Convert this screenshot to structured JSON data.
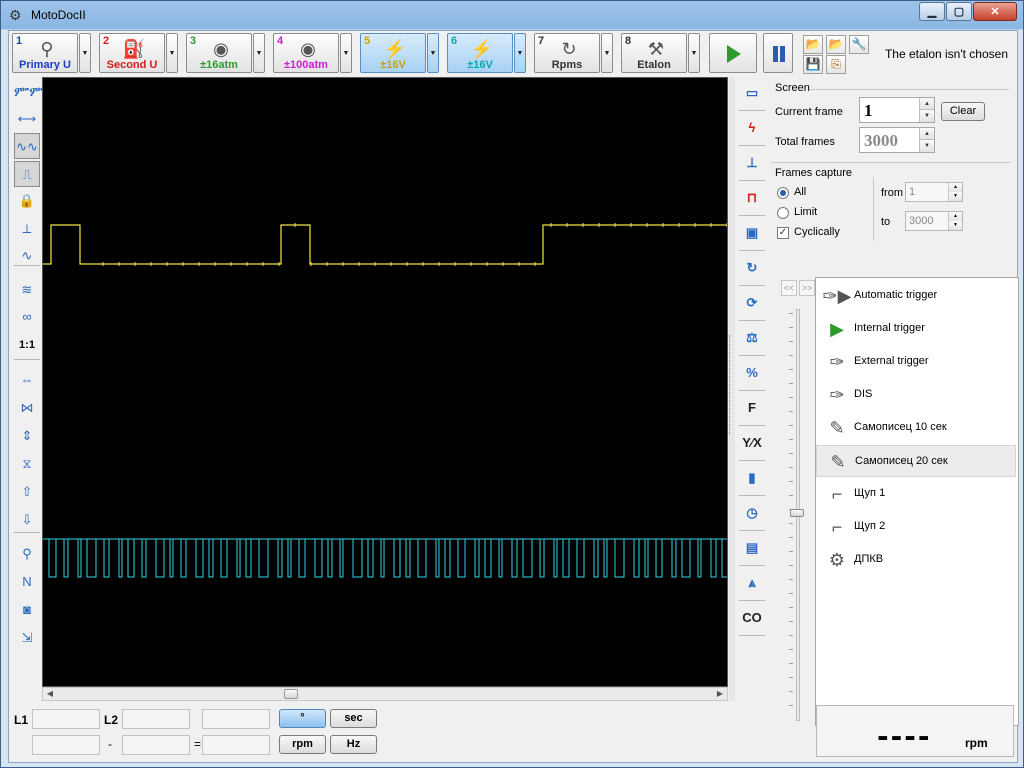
{
  "window": {
    "title": "MotoDocII",
    "min_label": "▁",
    "max_label": "▢",
    "close_label": "✕"
  },
  "toolbar": {
    "channels": [
      {
        "num": "1",
        "label": "Primary U",
        "num_color": "#1a3cc8",
        "label_color": "#1a3cc8",
        "icon": "ignition-coil-icon",
        "glyph": "⚲",
        "active": false
      },
      {
        "num": "2",
        "label": "Second U",
        "num_color": "#d01c1c",
        "label_color": "#d01c1c",
        "icon": "spark-plug-icon",
        "glyph": "⛽",
        "active": false
      },
      {
        "num": "3",
        "label": "±16atm",
        "num_color": "#2e9a2e",
        "label_color": "#2e9a2e",
        "icon": "pressure-sensor-icon",
        "glyph": "◉",
        "active": false
      },
      {
        "num": "4",
        "label": "±100atm",
        "num_color": "#d01cd0",
        "label_color": "#d01cd0",
        "icon": "pressure-sensor-icon",
        "glyph": "◉",
        "active": false
      },
      {
        "num": "5",
        "label": "±16V",
        "num_color": "#c9a400",
        "label_color": "#c9a400",
        "icon": "probe-icon",
        "glyph": "⚡",
        "active": true
      },
      {
        "num": "6",
        "label": "±16V",
        "num_color": "#0aa6b0",
        "label_color": "#0aa6b0",
        "icon": "probe-icon",
        "glyph": "⚡",
        "active": true
      },
      {
        "num": "7",
        "label": "Rpms",
        "num_color": "#333333",
        "label_color": "#333333",
        "icon": "rpm-icon",
        "glyph": "↻",
        "active": false
      },
      {
        "num": "8",
        "label": "Etalon",
        "num_color": "#333333",
        "label_color": "#333333",
        "icon": "etalon-icon",
        "glyph": "⚒",
        "active": false
      }
    ],
    "dropdown_glyph": "▼",
    "etalon_status": "The etalon isn't chosen"
  },
  "screen": {
    "group_title": "Screen",
    "current_frame_label": "Current frame",
    "current_frame_value": "1",
    "total_frames_label": "Total frames",
    "total_frames_value": "3000",
    "clear_label": "Clear"
  },
  "capture": {
    "group_title": "Frames capture",
    "all_label": "All",
    "limit_label": "Limit",
    "cyclically_label": "Cyclically",
    "cyclically_checked": "✓",
    "from_label": "from",
    "from_value": "1",
    "to_label": "to",
    "to_value": "3000"
  },
  "triggers": [
    {
      "label": "Automatic trigger",
      "icon": "automatic-trigger-icon",
      "glyph": "✑▶",
      "selected": false
    },
    {
      "label": "Internal trigger",
      "icon": "internal-trigger-icon",
      "glyph": "▶",
      "selected": false
    },
    {
      "label": "External trigger",
      "icon": "external-trigger-icon",
      "glyph": "✑",
      "selected": false
    },
    {
      "label": "DIS",
      "icon": "dis-trigger-icon",
      "glyph": "✑",
      "selected": false
    },
    {
      "label": "Самописец 10 сек",
      "icon": "recorder-icon",
      "glyph": "✎",
      "selected": false
    },
    {
      "label": "Самописец 20 сек",
      "icon": "recorder-icon",
      "glyph": "✎",
      "selected": true
    },
    {
      "label": "Щуп 1",
      "icon": "probe-1-icon",
      "glyph": "⌐",
      "selected": false
    },
    {
      "label": "Щуп 2",
      "icon": "probe-2-icon",
      "glyph": "⌐",
      "selected": false
    },
    {
      "label": "ДПКВ",
      "icon": "crank-sensor-icon",
      "glyph": "⚙",
      "selected": false
    }
  ],
  "nav": {
    "prev": "<<",
    "next": ">>"
  },
  "bottom": {
    "l1_label": "L1",
    "l2_label": "L2",
    "minus": "-",
    "equals": "=",
    "btn_degree": "°",
    "btn_sec": "sec",
    "btn_rpm": "rpm",
    "btn_hz": "Hz",
    "rpm_value": "----",
    "rpm_unit": "rpm"
  },
  "left_tools": [
    {
      "name": "channel-sync-icon",
      "glyph": "ᎃᎃ"
    },
    {
      "name": "angle-720-icon",
      "glyph": "⟷"
    },
    {
      "name": "waveform-mode-icon",
      "glyph": "∿∿"
    },
    {
      "name": "pulse-mode-icon",
      "glyph": "⎍"
    },
    {
      "name": "lock-channel-icon",
      "glyph": "🔒"
    },
    {
      "name": "cursor-marker-icon",
      "glyph": "⟂"
    },
    {
      "name": "sine-icon",
      "glyph": "∿"
    },
    {
      "name": "multi-wave-icon",
      "glyph": "≋"
    },
    {
      "name": "overlay-wave-icon",
      "glyph": "∞"
    },
    {
      "name": "scale-1-1-icon",
      "glyph": "1:1"
    },
    {
      "name": "expand-horizontal-icon",
      "glyph": "⇔"
    },
    {
      "name": "compress-horizontal-icon",
      "glyph": "⋈"
    },
    {
      "name": "expand-vertical-icon",
      "glyph": "⇕"
    },
    {
      "name": "compress-vertical-icon",
      "glyph": "⧖"
    },
    {
      "name": "move-up-icon",
      "glyph": "⇧"
    },
    {
      "name": "move-down-icon",
      "glyph": "⇩"
    },
    {
      "name": "zoom-search-icon",
      "glyph": "⚲"
    },
    {
      "name": "signal-marker-icon",
      "glyph": "N"
    },
    {
      "name": "camera-icon",
      "glyph": "◙"
    },
    {
      "name": "export-icon",
      "glyph": "⇲"
    }
  ],
  "right_tools": [
    {
      "name": "monitor-icon",
      "glyph": "▭"
    },
    {
      "name": "ignition-icon",
      "glyph": "ϟ"
    },
    {
      "name": "pulse-low-icon",
      "glyph": "⊥"
    },
    {
      "name": "pulse-high-icon",
      "glyph": "⊓"
    },
    {
      "name": "injector-icon",
      "glyph": "▣"
    },
    {
      "name": "rotate-icon",
      "glyph": "↻"
    },
    {
      "name": "rotate-cycle-icon",
      "glyph": "⟳"
    },
    {
      "name": "balance-icon",
      "glyph": "⚖"
    },
    {
      "name": "duty-cycle-icon",
      "glyph": "%"
    },
    {
      "name": "frequency-icon",
      "glyph": "F"
    },
    {
      "name": "ratio-icon",
      "glyph": "Y⁄X"
    },
    {
      "name": "battery-icon",
      "glyph": "▮"
    },
    {
      "name": "clock-icon",
      "glyph": "◷"
    },
    {
      "name": "device-icon",
      "glyph": "▤"
    },
    {
      "name": "spectrum-icon",
      "glyph": "⩓"
    },
    {
      "name": "co-icon",
      "glyph": "CO"
    }
  ]
}
